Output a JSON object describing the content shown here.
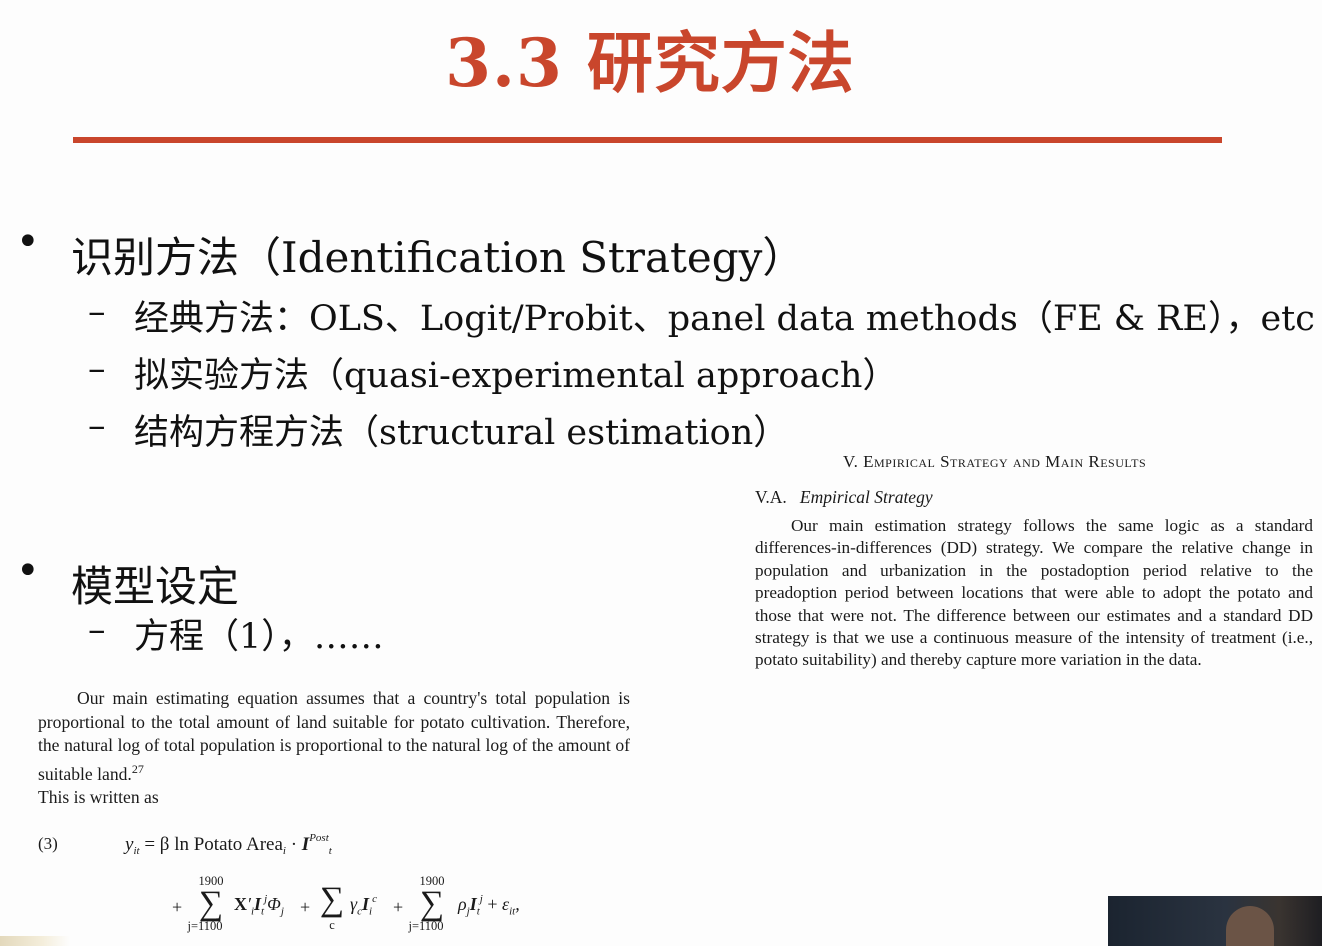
{
  "slide": {
    "title": "3.3 研究方法",
    "accent_color": "#c9462c"
  },
  "bullets": [
    {
      "label": "识别方法（Identification Strategy）",
      "subitems": [
        "经典方法：OLS、Logit/Probit、panel data methods（FE & RE），etc",
        "拟实验方法（quasi-experimental approach）",
        "结构方程方法（structural estimation）"
      ]
    },
    {
      "label": "模型设定",
      "subitems": [
        "方程（1），……"
      ]
    }
  ],
  "paper_right": {
    "section_num": "V.",
    "section_title": "Empirical Strategy and Main Results",
    "subsection_num": "V.A.",
    "subsection_title": "Empirical Strategy",
    "paragraph": "Our main estimation strategy follows the same logic as a standard differences-in-differences (DD) strategy. We compare the relative change in population and urbanization in the postadoption period relative to the preadoption period between locations that were able to adopt the potato and those that were not. The difference between our estimates and a standard DD strategy is that we use a continuous measure of the intensity of treatment (i.e., potato suitability) and thereby capture more variation in the data."
  },
  "paper_left": {
    "paragraph": "Our main estimating equation assumes that a country's total population is proportional to the total amount of land suitable for potato cultivation. Therefore, the natural log of total population is proportional to the natural log of the amount of suitable land.",
    "footnote": "27",
    "lead_in": "This is written as"
  },
  "equation": {
    "number": "(3)",
    "lhs": "y",
    "lhs_sub": "it",
    "rhs_text": " = β ln Potato Area",
    "rhs_sub": "i",
    "indicator": "I",
    "indicator_sup": "Post",
    "indicator_sub": "t",
    "sum_upper": "1900",
    "sum_lower": "j=1100",
    "sum_c_lower": "c",
    "error_term": "ε"
  },
  "webcam": {
    "visible": true
  }
}
